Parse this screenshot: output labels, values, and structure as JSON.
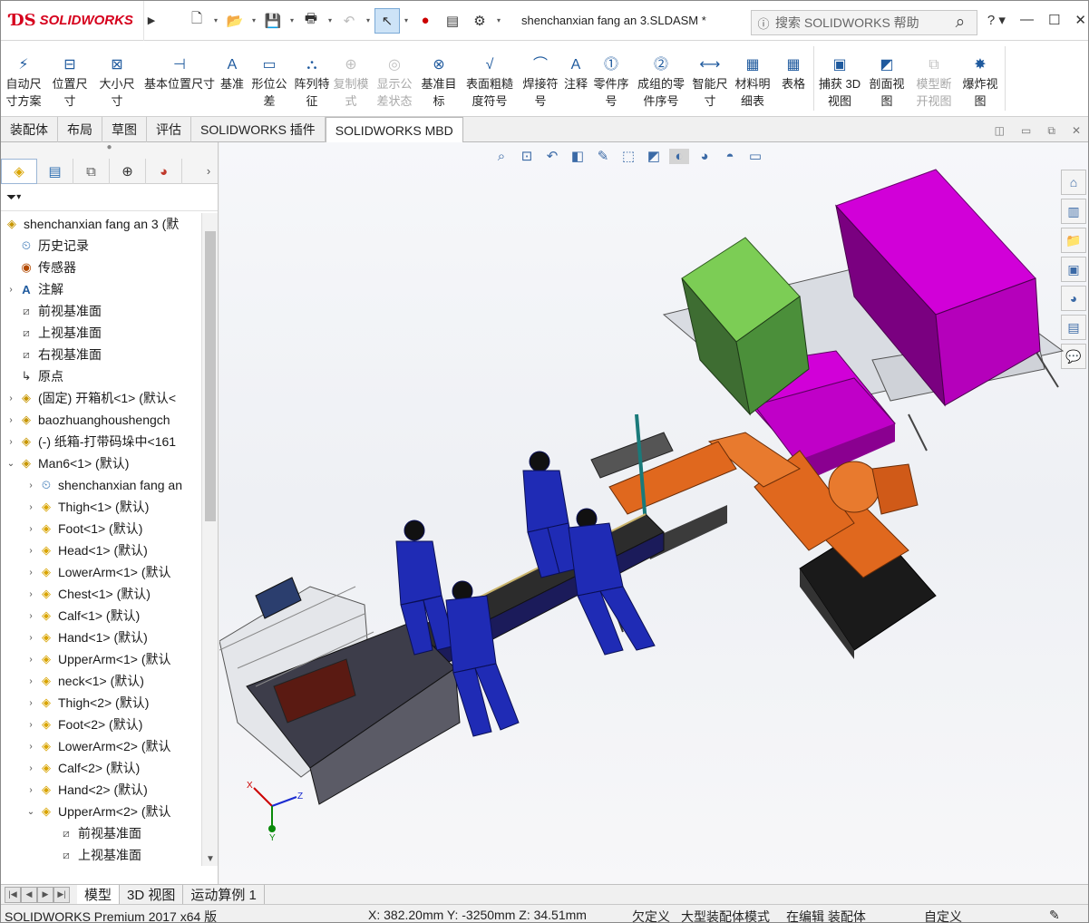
{
  "app": {
    "brand": "SOLIDWORKS",
    "document_title": "shenchanxian fang an 3.SLDASM *",
    "search_placeholder": "搜索 SOLIDWORKS 帮助"
  },
  "ribbon": {
    "buttons": [
      {
        "label": "自动尺\n寸方案",
        "icon": "auto-dimension-icon",
        "enabled": true
      },
      {
        "label": "位置尺\n寸",
        "icon": "location-dimension-icon",
        "enabled": true
      },
      {
        "label": "大小尺\n寸",
        "icon": "size-dimension-icon",
        "enabled": true
      },
      {
        "label": "基本位置尺寸",
        "icon": "basic-location-dimension-icon",
        "enabled": true
      },
      {
        "label": "基准",
        "icon": "datum-icon",
        "enabled": true
      },
      {
        "label": "形位公\n差",
        "icon": "geometric-tolerance-icon",
        "enabled": true
      },
      {
        "label": "阵列特\n征",
        "icon": "pattern-feature-icon",
        "enabled": true
      },
      {
        "label": "复制模\n式",
        "icon": "copy-scheme-icon",
        "enabled": false
      },
      {
        "label": "显示公\n差状态",
        "icon": "show-tolerance-status-icon",
        "enabled": false
      },
      {
        "label": "基准目\n标",
        "icon": "datum-target-icon",
        "enabled": true
      },
      {
        "label": "表面粗糙\n度符号",
        "icon": "surface-finish-icon",
        "enabled": true
      },
      {
        "label": "焊接符\n号",
        "icon": "weld-symbol-icon",
        "enabled": true
      },
      {
        "label": "注释",
        "icon": "note-icon",
        "enabled": true
      },
      {
        "label": "零件序\n号",
        "icon": "balloon-icon",
        "enabled": true
      },
      {
        "label": "成组的零\n件序号",
        "icon": "stacked-balloon-icon",
        "enabled": true
      },
      {
        "label": "智能尺\n寸",
        "icon": "smart-dimension-icon",
        "enabled": true
      },
      {
        "label": "材料明\n细表",
        "icon": "bom-icon",
        "enabled": true
      },
      {
        "label": "表格",
        "icon": "table-icon",
        "enabled": true
      },
      {
        "label": "捕获 3D\n视图",
        "icon": "capture-3d-view-icon",
        "enabled": true
      },
      {
        "label": "剖面视\n图",
        "icon": "section-view-icon",
        "enabled": true
      },
      {
        "label": "模型断\n开视图",
        "icon": "model-break-view-icon",
        "enabled": false
      },
      {
        "label": "爆炸视\n图",
        "icon": "exploded-view-icon",
        "enabled": true
      }
    ]
  },
  "tabs": [
    {
      "label": "装配体",
      "active": false
    },
    {
      "label": "布局",
      "active": false
    },
    {
      "label": "草图",
      "active": false
    },
    {
      "label": "评估",
      "active": false
    },
    {
      "label": "SOLIDWORKS 插件",
      "active": false
    },
    {
      "label": "SOLIDWORKS MBD",
      "active": true
    }
  ],
  "tree": {
    "root": "shenchanxian fang an 3  (默",
    "items": [
      {
        "label": "历史记录",
        "icon": "history-icon",
        "toggle": "",
        "indent": 1
      },
      {
        "label": "传感器",
        "icon": "sensor-icon",
        "toggle": "",
        "indent": 1
      },
      {
        "label": "注解",
        "icon": "annotation-icon",
        "toggle": "›",
        "indent": 1
      },
      {
        "label": "前视基准面",
        "icon": "plane-icon",
        "toggle": "",
        "indent": 1
      },
      {
        "label": "上视基准面",
        "icon": "plane-icon",
        "toggle": "",
        "indent": 1
      },
      {
        "label": "右视基准面",
        "icon": "plane-icon",
        "toggle": "",
        "indent": 1
      },
      {
        "label": "原点",
        "icon": "origin-icon",
        "toggle": "",
        "indent": 1
      },
      {
        "label": "(固定) 开箱机<1> (默认<",
        "icon": "assembly-icon",
        "toggle": "›",
        "indent": 1
      },
      {
        "label": "baozhuanghoushengch",
        "icon": "assembly-icon",
        "toggle": "›",
        "indent": 1
      },
      {
        "label": "(-) 纸箱-打带码垛中<161",
        "icon": "assembly-icon",
        "toggle": "›",
        "indent": 1
      },
      {
        "label": "Man6<1> (默认)",
        "icon": "assembly-icon",
        "toggle": "⌄",
        "indent": 1
      },
      {
        "label": "shenchanxian fang an",
        "icon": "history-icon",
        "toggle": "›",
        "indent": 2
      },
      {
        "label": "Thigh<1> (默认)",
        "icon": "part-icon",
        "toggle": "›",
        "indent": 2
      },
      {
        "label": "Foot<1> (默认)",
        "icon": "part-icon",
        "toggle": "›",
        "indent": 2
      },
      {
        "label": "Head<1> (默认)",
        "icon": "part-icon",
        "toggle": "›",
        "indent": 2
      },
      {
        "label": "LowerArm<1> (默认",
        "icon": "part-icon",
        "toggle": "›",
        "indent": 2
      },
      {
        "label": "Chest<1> (默认)",
        "icon": "part-icon",
        "toggle": "›",
        "indent": 2
      },
      {
        "label": "Calf<1> (默认)",
        "icon": "part-icon",
        "toggle": "›",
        "indent": 2
      },
      {
        "label": "Hand<1> (默认)",
        "icon": "part-icon",
        "toggle": "›",
        "indent": 2
      },
      {
        "label": "UpperArm<1> (默认",
        "icon": "part-icon",
        "toggle": "›",
        "indent": 2
      },
      {
        "label": "neck<1> (默认)",
        "icon": "part-icon",
        "toggle": "›",
        "indent": 2
      },
      {
        "label": "Thigh<2> (默认)",
        "icon": "part-icon",
        "toggle": "›",
        "indent": 2
      },
      {
        "label": "Foot<2> (默认)",
        "icon": "part-icon",
        "toggle": "›",
        "indent": 2
      },
      {
        "label": "LowerArm<2> (默认",
        "icon": "part-icon",
        "toggle": "›",
        "indent": 2
      },
      {
        "label": "Calf<2> (默认)",
        "icon": "part-icon",
        "toggle": "›",
        "indent": 2
      },
      {
        "label": "Hand<2> (默认)",
        "icon": "part-icon",
        "toggle": "›",
        "indent": 2
      },
      {
        "label": "UpperArm<2> (默认",
        "icon": "part-icon",
        "toggle": "⌄",
        "indent": 2
      },
      {
        "label": "前视基准面",
        "icon": "plane-icon",
        "toggle": "",
        "indent": 3
      },
      {
        "label": "上视基准面",
        "icon": "plane-icon",
        "toggle": "",
        "indent": 3
      }
    ]
  },
  "bottom_tabs": [
    {
      "label": "模型",
      "active": true
    },
    {
      "label": "3D 视图",
      "active": false
    },
    {
      "label": "运动算例 1",
      "active": false
    }
  ],
  "status": {
    "product": "SOLIDWORKS Premium 2017 x64 版",
    "coords": "X: 382.20mm Y: -3250mm Z: 34.51mm",
    "defined": "欠定义",
    "mode": "大型装配体模式",
    "editing": "在编辑 装配体",
    "custom": "自定义"
  },
  "colors": {
    "brand_red": "#d6001c",
    "pallet_magenta": "#d100d8",
    "boxes_green": "#4b8f3a",
    "robot_orange": "#e0681e",
    "worker_blue": "#1f2bb5"
  }
}
